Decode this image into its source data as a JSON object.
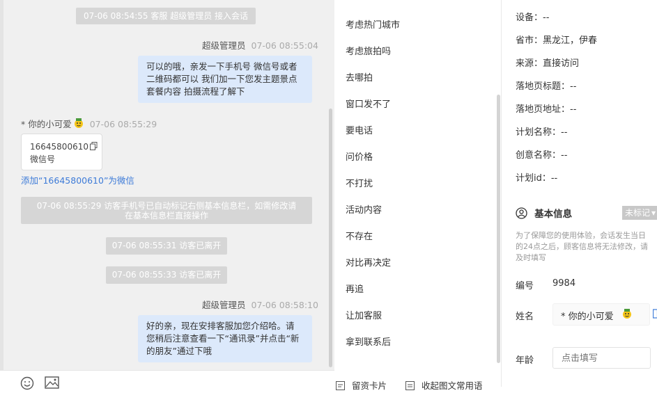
{
  "chat": {
    "messages": {
      "sys_join": "07-06 08:54:55 客服 超级管理员 接入会话",
      "agent1_name": "超级管理员",
      "agent1_time": "07-06 08:55:04",
      "agent1_line1": "可以的哦，亲发一下手机号 微信号或者",
      "agent1_line2": "二维码都可以 我们加一下您发主题景点",
      "agent1_line3": "套餐内容 拍摄流程了解下",
      "visitor_name": "* 你的小可爱",
      "visitor_time": "07-06 08:55:29",
      "card_number": "16645800610",
      "card_type": "微信号",
      "add_wechat_link": "添加“16645800610”为微信",
      "sys_phone_line1": "07-06 08:55:29 访客手机号已自动标记右侧基本信息栏，如需修改请",
      "sys_phone_line2": "在基本信息栏直接操作",
      "sys_left1": "07-06 08:55:31 访客已离开",
      "sys_left2": "07-06 08:55:33 访客已离开",
      "agent2_name": "超级管理员",
      "agent2_time": "07-06 08:58:10",
      "agent2_line1": "好的亲，现在安排客服加您介绍哈。请",
      "agent2_line2": "您稍后注意查看一下“通讯录”并点击“新",
      "agent2_line3": "的朋友”通过下哦"
    }
  },
  "quick_replies": {
    "items": [
      "考虑热门城市",
      "考虑旅拍吗",
      "去哪拍",
      "窗口发不了",
      "要电话",
      "问价格",
      "不打扰",
      "活动内容",
      "不存在",
      "对比再决定",
      "再追",
      "让加客服",
      "拿到联系后"
    ],
    "footer_left": "留资卡片",
    "footer_right": "收起图文常用语"
  },
  "info": {
    "device": "设备：--",
    "province": "省市：黑龙江，伊春",
    "source": "来源：直接访问",
    "landing_title": "落地页标题：--",
    "landing_url": "落地页地址：--",
    "plan_name": "计划名称：--",
    "creative_name": "创意名称：--",
    "plan_id": "计划id：--",
    "section_title": "基本信息",
    "tag_select": "未标记",
    "hint_line1": "为了保障您的使用体验，会话发生当日",
    "hint_line2": "的24点之后，顾客信息将无法修改，请",
    "hint_line3": "及时填写",
    "id_label": "编号",
    "id_value": "9984",
    "name_label": "姓名",
    "name_value": "* 你的小可爱",
    "age_label": "年龄",
    "age_placeholder": "点击填写"
  }
}
